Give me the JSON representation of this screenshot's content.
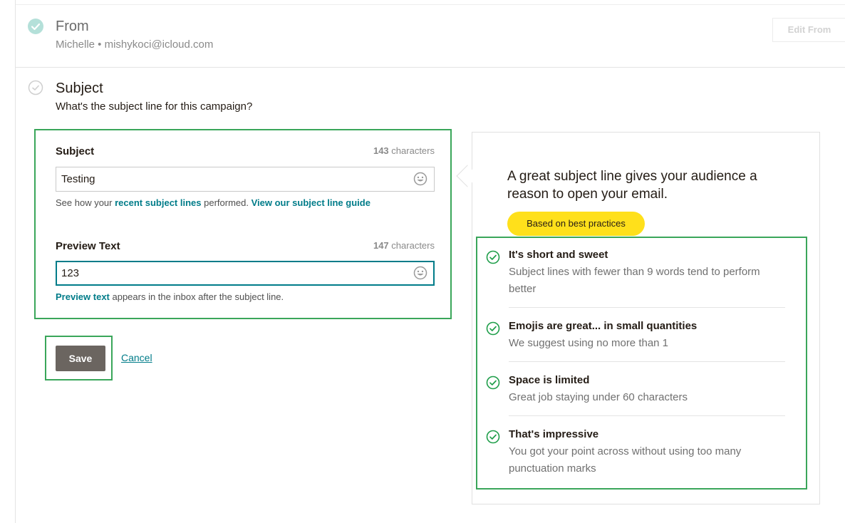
{
  "from": {
    "title": "From",
    "detail": "Michelle • mishykoci@icloud.com",
    "edit_button": "Edit From",
    "check_icon": "check-circle-filled-icon"
  },
  "subject_section": {
    "title": "Subject",
    "description": "What's the subject line for this campaign?",
    "check_icon": "check-circle-outline-icon"
  },
  "form": {
    "subject": {
      "label": "Subject",
      "count_value": "143",
      "count_suffix": "characters",
      "value": "Testing",
      "emoji_icon": "smiley-icon",
      "help_prefix": "See how your ",
      "help_link1": "recent subject lines",
      "help_middle": " performed. ",
      "help_link2": "View our subject line guide"
    },
    "preview": {
      "label": "Preview Text",
      "count_value": "147",
      "count_suffix": "characters",
      "value": "123",
      "emoji_icon": "smiley-icon",
      "help_link": "Preview text",
      "help_suffix": " appears in the inbox after the subject line."
    }
  },
  "actions": {
    "save": "Save",
    "cancel": "Cancel"
  },
  "tips": {
    "heading": "A great subject line gives your audience a reason to open your email.",
    "badge": "Based on best practices",
    "items": [
      {
        "title": "It's short and sweet",
        "desc": "Subject lines with fewer than 9 words tend to perform better"
      },
      {
        "title": "Emojis are great... in small quantities",
        "desc": "We suggest using no more than 1"
      },
      {
        "title": "Space is limited",
        "desc": "Great job staying under 60 characters"
      },
      {
        "title": "That's impressive",
        "desc": "You got your point across without using too many punctuation marks"
      }
    ],
    "check_icon": "check-circle-green-icon"
  },
  "colors": {
    "accent": "#007c89",
    "highlight_border": "#3aa65a",
    "badge": "#ffe01b",
    "save_button": "#6b6560"
  }
}
